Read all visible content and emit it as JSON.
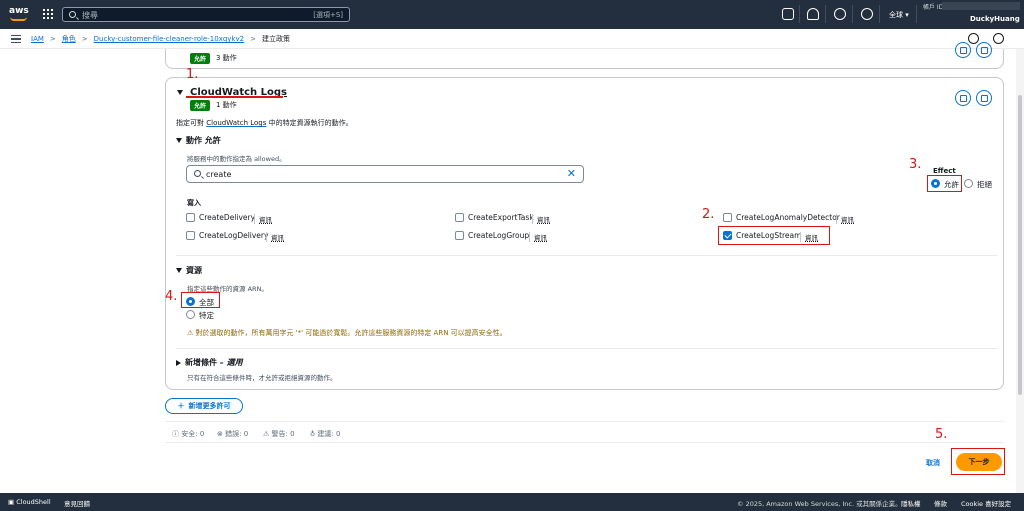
{
  "topnav": {
    "logo": "aws",
    "search_placeholder": "搜尋",
    "search_shortcut": "[選項+S]",
    "region": "全球 ▾",
    "account_label": "帳戶 ID:",
    "user": "DuckyHuang"
  },
  "breadcrumb": {
    "items": [
      "IAM",
      "角色",
      "Ducky-customer-file-cleaner-role-10xqykv2"
    ],
    "current": "建立政策"
  },
  "prev_section": {
    "badge": "允許",
    "count": "3 動作"
  },
  "service": {
    "title": "CloudWatch Logs",
    "badge": "允許",
    "count": "1 動作",
    "description_pre": "指定可對 ",
    "description_link": "CloudWatch Logs",
    "description_post": " 中的特定資源執行的動作。"
  },
  "actions": {
    "heading_prefix": "動作",
    "heading_value": "允許",
    "subtext": "將服務中的動作指定為 allowed。",
    "search_value": "create",
    "group_label": "寫入",
    "items": [
      {
        "label": "CreateDelivery",
        "info": "資訊",
        "checked": false
      },
      {
        "label": "CreateExportTask",
        "info": "資訊",
        "checked": false
      },
      {
        "label": "CreateLogAnomalyDetector",
        "info": "資訊",
        "checked": false
      },
      {
        "label": "CreateLogDelivery",
        "info": "資訊",
        "checked": false
      },
      {
        "label": "CreateLogGroup",
        "info": "資訊",
        "checked": false
      },
      {
        "label": "CreateLogStream",
        "info": "資訊",
        "checked": true
      }
    ]
  },
  "effect": {
    "label": "Effect",
    "allow": "允許",
    "deny": "拒絕",
    "selected": "allow"
  },
  "resources": {
    "heading": "資源",
    "subtext": "指定這些動作的資源 ARN。",
    "all": "全部",
    "specific": "特定",
    "selected": "all",
    "warning": "對於選取的動作，所有萬用字元 '*' 可能過於寬鬆。允許這些服務資源的特定 ARN 可以提高安全性。"
  },
  "conditions": {
    "heading": "新增條件",
    "optional": "– 選用",
    "subtext": "只有在符合這些條件時，才允許或拒絕資源的動作。"
  },
  "add_more_label": "新增更多許可",
  "stats": {
    "security": "安全: 0",
    "errors": "錯誤: 0",
    "warnings": "警告: 0",
    "suggestions": "建議: 0"
  },
  "footer_actions": {
    "cancel": "取消",
    "next": "下一步"
  },
  "annotations": [
    "1.",
    "2.",
    "3.",
    "4.",
    "5."
  ],
  "footer": {
    "cloudshell": "CloudShell",
    "feedback": "意見回饋",
    "copyright": "© 2025, Amazon Web Services, Inc. 或其關係企業。",
    "privacy": "隱私權",
    "terms": "條款",
    "cookie": "Cookie 喜好設定"
  },
  "colors": {
    "nav_bg": "#232f3e",
    "link": "#0972d3",
    "allow_badge": "#037f0c",
    "primary_button": "#ff9900",
    "annotation": "#d91515"
  }
}
